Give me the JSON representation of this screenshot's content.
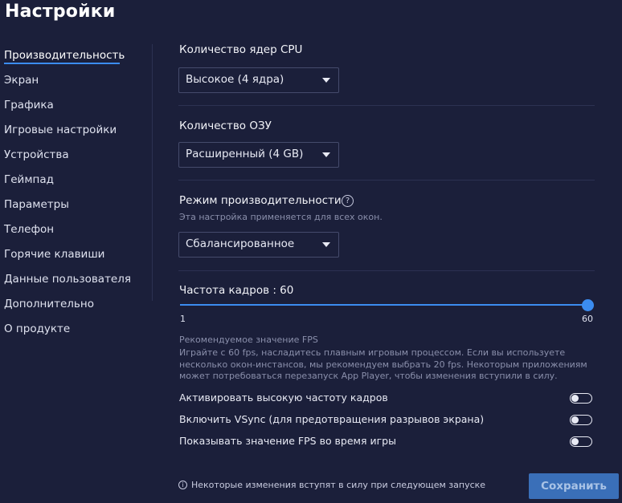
{
  "page": {
    "title": "Настройки"
  },
  "sidebar": {
    "items": [
      {
        "label": "Производительность",
        "active": true
      },
      {
        "label": "Экран"
      },
      {
        "label": "Графика"
      },
      {
        "label": "Игровые настройки"
      },
      {
        "label": "Устройства"
      },
      {
        "label": "Геймпад"
      },
      {
        "label": "Параметры"
      },
      {
        "label": "Телефон"
      },
      {
        "label": "Горячие клавиши"
      },
      {
        "label": "Данные пользователя"
      },
      {
        "label": "Дополнительно"
      },
      {
        "label": "О продукте"
      }
    ]
  },
  "main": {
    "cpu": {
      "label": "Количество ядер CPU",
      "value": "Высокое (4 ядра)"
    },
    "ram": {
      "label": "Количество ОЗУ",
      "value": "Расширенный (4 GB)"
    },
    "mode": {
      "label": "Режим производительности",
      "help_icon": "?",
      "note": "Эта настройка применяется для всех окон.",
      "value": "Сбалансированное"
    },
    "fps": {
      "label": "Частота кадров : 60",
      "min": "1",
      "max": "60",
      "value": 60,
      "recommend_title": "Рекомендуемое значение FPS",
      "recommend_text": "Играйте с 60 fps, насладитесь плавным игровым процессом. Если вы используете несколько окон-инстансов, мы рекомендуем выбрать 20 fps. Некоторым приложениям может потребоваться перезапуск App Player, чтобы изменения вступили в силу."
    },
    "toggles": [
      {
        "label": "Активировать высокую частоту кадров",
        "on": false
      },
      {
        "label": "Включить VSync (для предотвращения разрывов экрана)",
        "on": false
      },
      {
        "label": "Показывать значение FPS во время игры",
        "on": false
      }
    ]
  },
  "footer": {
    "info_icon": "i",
    "note": "Некоторые изменения вступят в силу при следующем запуске",
    "save_label": "Сохранить"
  },
  "colors": {
    "background": "#1b1f3a",
    "accent": "#3b8cf0",
    "button": "#3a6fb8"
  }
}
